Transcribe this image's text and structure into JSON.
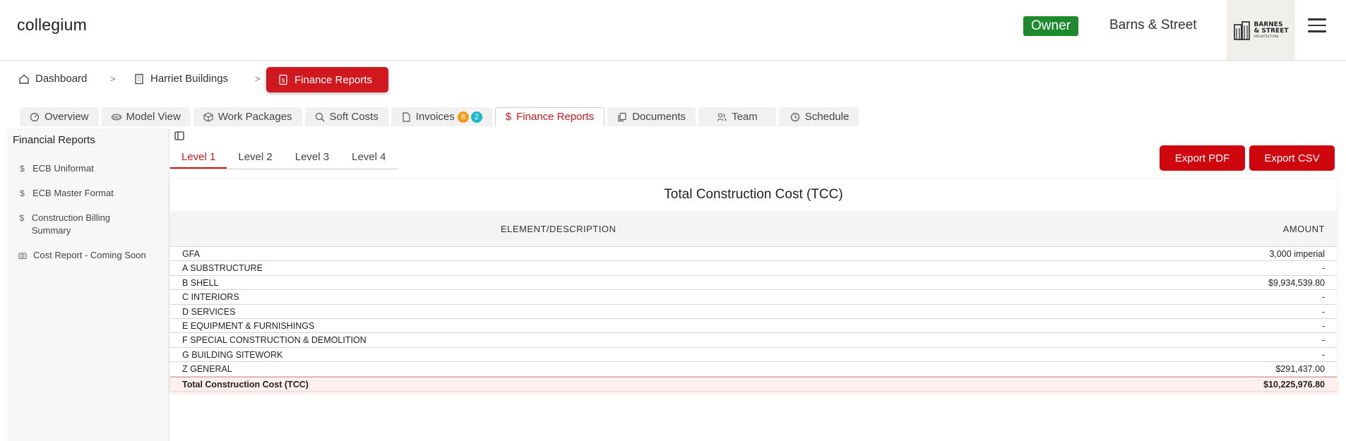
{
  "header": {
    "brand": "collegium",
    "role": "Owner",
    "company": "Barns & Street",
    "logo_text_line1": "BARNES",
    "logo_text_line2": "& STREET",
    "logo_text_line3": "ARCHITECTURE"
  },
  "breadcrumb": {
    "items": [
      "Dashboard",
      "Harriet Buildings"
    ],
    "separator": ">",
    "active": "Finance Reports"
  },
  "tabs": {
    "items": [
      "Overview",
      "Model View",
      "Work Packages",
      "Soft Costs",
      "Invoices",
      "Finance Reports",
      "Documents",
      "Team",
      "Schedule"
    ],
    "invoice_badge_1": "8",
    "invoice_badge_2": "2",
    "active": "Finance Reports"
  },
  "sidebar": {
    "title": "Financial Reports",
    "items": [
      {
        "label": "ECB Uniformat",
        "icon": "dollar-icon"
      },
      {
        "label": "ECB Master Format",
        "icon": "dollar-icon"
      },
      {
        "label": "Construction Billing Summary",
        "icon": "dollar-icon"
      },
      {
        "label": "Cost Report - Coming Soon",
        "icon": "camera-icon"
      }
    ]
  },
  "levels": {
    "items": [
      "Level 1",
      "Level 2",
      "Level 3",
      "Level 4"
    ],
    "active": "Level 1"
  },
  "actions": {
    "export_pdf": "Export PDF",
    "export_csv": "Export CSV"
  },
  "report": {
    "title": "Total Construction Cost (TCC)",
    "col_desc": "ELEMENT/DESCRIPTION",
    "col_amount": "AMOUNT",
    "rows": [
      {
        "desc": "GFA",
        "amount": "3,000 imperial"
      },
      {
        "desc": "A SUBSTRUCTURE",
        "amount": "-"
      },
      {
        "desc": "B SHELL",
        "amount": "$9,934,539.80"
      },
      {
        "desc": "C INTERIORS",
        "amount": "-"
      },
      {
        "desc": "D SERVICES",
        "amount": "-"
      },
      {
        "desc": "E EQUIPMENT & FURNISHINGS",
        "amount": "-"
      },
      {
        "desc": "F SPECIAL CONSTRUCTION & DEMOLITION",
        "amount": "-"
      },
      {
        "desc": "G BUILDING SITEWORK",
        "amount": "-"
      },
      {
        "desc": "Z GENERAL",
        "amount": "$291,437.00"
      }
    ],
    "total": {
      "desc": "Total Construction Cost (TCC)",
      "amount": "$10,225,976.80"
    }
  },
  "colors": {
    "accent": "#d0181f",
    "owner_badge": "#1e8a2e",
    "badge_orange": "#f39c12",
    "badge_teal": "#1cb7c9"
  }
}
